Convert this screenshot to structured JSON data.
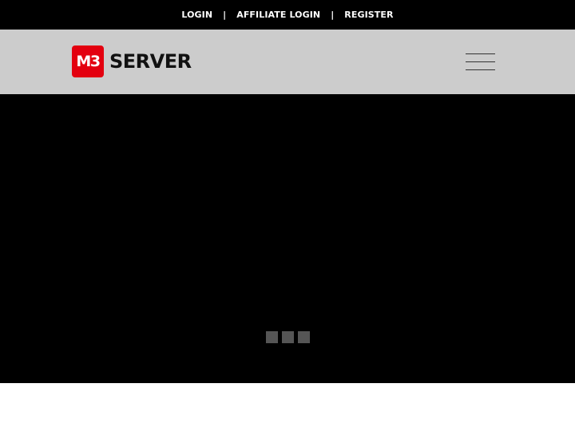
{
  "topbar": {
    "links": [
      {
        "label": "LOGIN"
      },
      {
        "label": "AFFILIATE LOGIN"
      },
      {
        "label": "REGISTER"
      }
    ],
    "separator": "|"
  },
  "header": {
    "logo_mark": "M3",
    "logo_text": "SERVER",
    "menu_icon": "hamburger-menu-icon"
  },
  "hero": {
    "loader_icon": "loading-dots-icon"
  },
  "colors": {
    "topbar_bg": "#000000",
    "header_bg": "#cccccc",
    "brand_red": "#e3000f",
    "hero_bg": "#000000",
    "loader_dot": "#555555"
  }
}
